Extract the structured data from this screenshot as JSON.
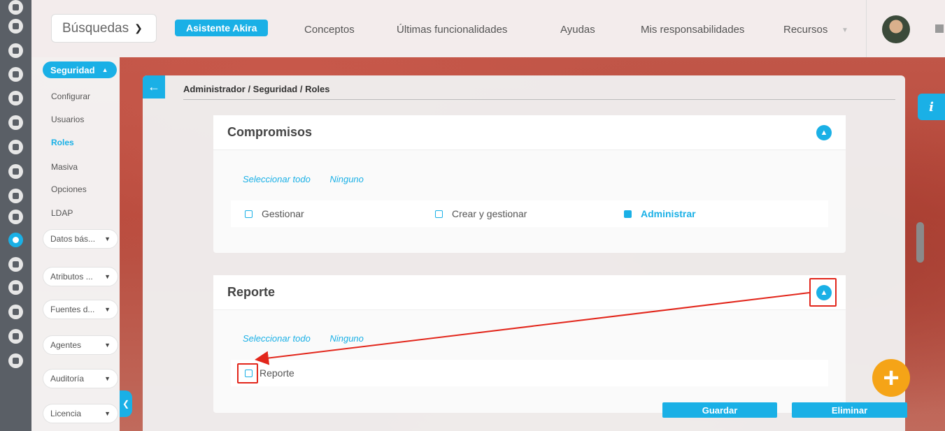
{
  "topbar": {
    "search_label": "Búsquedas",
    "akira_label": "Asistente Akira",
    "nav": [
      "Conceptos",
      "Últimas funcionalidades",
      "Ayudas",
      "Mis responsabilidades",
      "Recursos"
    ]
  },
  "sidebar": {
    "section_label": "Seguridad",
    "sub_items": [
      "Configurar",
      "Usuarios",
      "Roles",
      "Masiva",
      "Opciones",
      "LDAP"
    ],
    "active_item": "Roles",
    "groups": [
      "Datos bás...",
      "Atributos ...",
      "Fuentes d...",
      "Agentes",
      "Auditoría",
      "Licencia"
    ]
  },
  "main": {
    "breadcrumb": "Administrador / Seguridad / Roles",
    "cards": [
      {
        "title": "Compromisos",
        "select_all": "Seleccionar todo",
        "none": "Ninguno",
        "options": [
          {
            "label": "Gestionar",
            "checked": false
          },
          {
            "label": "Crear y gestionar",
            "checked": false
          },
          {
            "label": "Administrar",
            "checked": true
          }
        ]
      },
      {
        "title": "Reporte",
        "select_all": "Seleccionar todo",
        "none": "Ninguno",
        "options": [
          {
            "label": "Reporte",
            "checked": false
          }
        ]
      }
    ],
    "save_label": "Guardar",
    "delete_label": "Eliminar"
  },
  "info_label": "i",
  "accent_color": "#1ab0e6",
  "fab_color": "#f5a417",
  "annotation_color": "#e2261b"
}
